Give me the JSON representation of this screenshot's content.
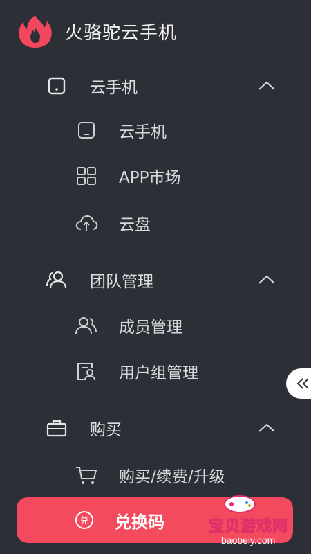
{
  "app": {
    "title": "火骆驼云手机"
  },
  "menu": {
    "sections": [
      {
        "label": "云手机",
        "items": [
          {
            "label": "云手机"
          },
          {
            "label": "APP市场"
          },
          {
            "label": "云盘"
          }
        ]
      },
      {
        "label": "团队管理",
        "items": [
          {
            "label": "成员管理"
          },
          {
            "label": "用户组管理"
          }
        ]
      },
      {
        "label": "购买",
        "items": [
          {
            "label": "购买/续费/升级"
          }
        ]
      }
    ]
  },
  "redeem": {
    "label": "兑换码",
    "icon_text": "兑"
  },
  "watermark": {
    "text": "宝贝游戏网",
    "url": "baobeiy.com"
  },
  "colors": {
    "background": "#2d2f37",
    "accent": "#f34b5d",
    "text": "#e8e8ea"
  }
}
